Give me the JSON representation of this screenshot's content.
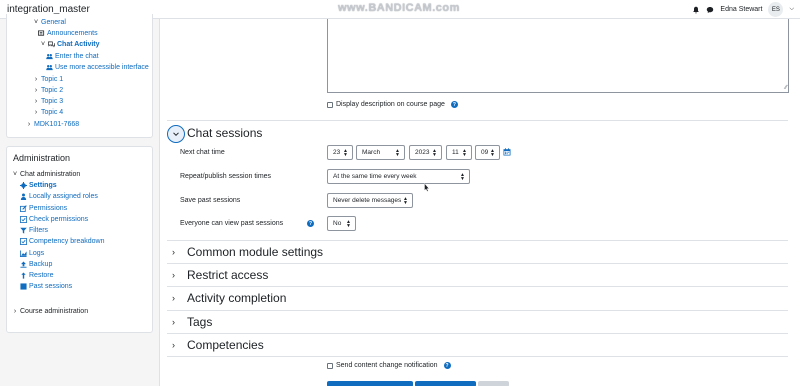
{
  "header": {
    "site_name": "integration_master",
    "watermark": "www.BANDICAM.com",
    "user_name": "Edna Stewart",
    "avatar_initials": "ES"
  },
  "course_nav": {
    "items": [
      {
        "label": "General",
        "expanded": true
      },
      {
        "label": "Announcements"
      },
      {
        "label": "Chat Activity",
        "expanded": true
      },
      {
        "label": "Enter the chat"
      },
      {
        "label": "Use more accessible interface"
      },
      {
        "label": "Topic 1"
      },
      {
        "label": "Topic 2"
      },
      {
        "label": "Topic 3"
      },
      {
        "label": "Topic 4"
      },
      {
        "label": "MDK101-7668"
      }
    ]
  },
  "admin_block": {
    "title": "Administration",
    "chat_admin_label": "Chat administration",
    "items": [
      {
        "label": "Settings",
        "icon": "gear-icon",
        "active": true
      },
      {
        "label": "Locally assigned roles",
        "icon": "user-icon"
      },
      {
        "label": "Permissions",
        "icon": "edit-icon"
      },
      {
        "label": "Check permissions",
        "icon": "check-permissions-icon"
      },
      {
        "label": "Filters",
        "icon": "filter-icon"
      },
      {
        "label": "Competency breakdown",
        "icon": "checkbox-icon"
      },
      {
        "label": "Logs",
        "icon": "chart-icon"
      },
      {
        "label": "Backup",
        "icon": "upload-icon"
      },
      {
        "label": "Restore",
        "icon": "restore-icon"
      },
      {
        "label": "Past sessions",
        "icon": "square-icon"
      }
    ],
    "course_admin_label": "Course administration"
  },
  "form": {
    "display_description_label": "Display description on course page",
    "chat_sessions": {
      "title": "Chat sessions",
      "next_chat_time_label": "Next chat time",
      "day": "23",
      "month": "March",
      "year": "2023",
      "hour": "11",
      "minute": "09",
      "repeat_label": "Repeat/publish session times",
      "repeat_value": "At the same time every week",
      "save_label": "Save past sessions",
      "save_value": "Never delete messages",
      "everyone_label": "Everyone can view past sessions",
      "everyone_value": "No"
    },
    "sections": [
      {
        "title": "Common module settings"
      },
      {
        "title": "Restrict access"
      },
      {
        "title": "Activity completion"
      },
      {
        "title": "Tags"
      },
      {
        "title": "Competencies"
      }
    ],
    "send_notification_label": "Send content change notification"
  },
  "colors": {
    "link": "#0f6cbf",
    "primary_button": "#0f6cbf",
    "secondary_button": "#ced4da"
  }
}
